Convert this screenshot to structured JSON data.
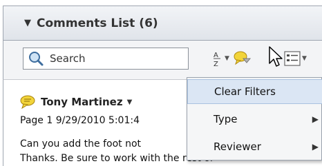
{
  "panel": {
    "collapse_icon": "triangle-down-icon",
    "title": "Comments List",
    "count": "(6)"
  },
  "toolbar": {
    "search_placeholder": "Search",
    "sort_icon": "sort-az-icon",
    "filter_icon": "comment-filter-icon",
    "options_icon": "list-options-icon"
  },
  "comment": {
    "author": "Tony Martinez",
    "meta": "Page 1  9/29/2010 5:01:4",
    "text_line1": "Can you add the foot not",
    "text_line2": "Thanks. Be sure to work with the rest of"
  },
  "menu": {
    "items": [
      {
        "label": "Clear Filters",
        "highlighted": true,
        "submenu": false
      },
      {
        "label": "Type",
        "highlighted": false,
        "submenu": true
      },
      {
        "label": "Reviewer",
        "highlighted": false,
        "submenu": true
      }
    ]
  },
  "colors": {
    "header_bg": "#e4e7ec",
    "menu_highlight": "#dbe6f4",
    "comment_bubble": "#f2d43a"
  }
}
